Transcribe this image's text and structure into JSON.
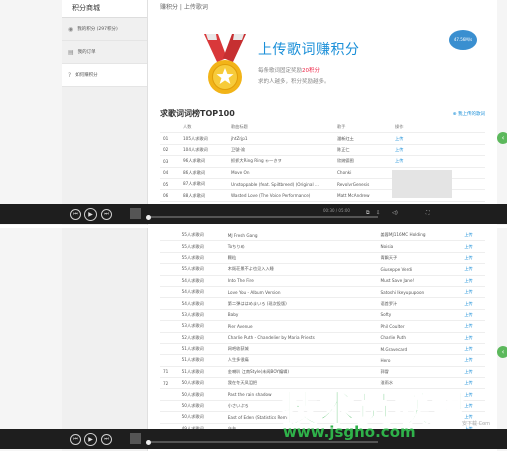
{
  "top": {
    "sidebar": {
      "header": "积分商城",
      "items": [
        {
          "label": "我的积分 (297积分)",
          "icon": "coin-icon"
        },
        {
          "label": "我的订单",
          "icon": "list-icon"
        },
        {
          "label": "如何赚积分",
          "icon": "question-icon"
        }
      ]
    },
    "breadcrumb": "赚积分  |  上传歌词",
    "hero": {
      "title": "上传歌词赚积分",
      "line1_pre": "每条歌词固定奖励",
      "line1_hl": "20积分",
      "line2": "求的人越多，积分奖励越多。"
    },
    "section": {
      "title": "求歌词词榜TOP100",
      "link": "我上传的歌词"
    },
    "table": {
      "headers": [
        "",
        "人数",
        "歌曲标题",
        "歌手",
        "操作"
      ],
      "rows": [
        [
          "01",
          "105人求歌词",
          "jhtZrjp1",
          "潘新红土",
          "上传"
        ],
        [
          "02",
          "104人求歌词",
          "卫號-渝",
          "陈正仁",
          "上传"
        ],
        [
          "03",
          "96人求歌词",
          "抓抓大Ring Ring ゃ一きヲ",
          "欣婉德图",
          "上传"
        ],
        [
          "04",
          "86人求歌词",
          "Move On",
          "Chonki",
          "上传"
        ],
        [
          "05",
          "87人求歌词",
          "Unstoppable (feat. Spiltbreed) (Original ...",
          "RevolvrGenesis",
          "上传"
        ],
        [
          "06",
          "88人求歌词",
          "Wasted Love (The Voice Performance)",
          "Matt McAndrew",
          "上传"
        ]
      ]
    },
    "player": {
      "time": "00:30 / 05:00"
    },
    "badge": "47.56M/s"
  },
  "bottom": {
    "table": {
      "rows": [
        [
          "",
          "55人求歌词",
          "MJ Fresh Gang",
          "姜蓉MJ116MC Holding",
          "上传"
        ],
        [
          "",
          "55人求歌词",
          "Toちりめ",
          "Noisia",
          "上传"
        ],
        [
          "",
          "55人求歌词",
          "颗粒",
          "青飘天子",
          "上传"
        ],
        [
          "",
          "55人求歌词",
          "木既荘景不よ也见入入睡",
          "Giuseppe Verdi",
          "上传"
        ],
        [
          "",
          "54人求歌词",
          "Into The Fire",
          "Must Save Jane!",
          "上传"
        ],
        [
          "",
          "54人求歌词",
          "Love You - Album Version",
          "Satoshi Ikeyupupoon",
          "上传"
        ],
        [
          "",
          "54人求歌词",
          "第二弹ははめまいろ (现次投版)",
          "语首罗汁",
          "上传"
        ],
        [
          "",
          "53人求歌词",
          "Baby",
          "Softy",
          "上传"
        ],
        [
          "",
          "53人求歌词",
          "Pier Avenue",
          "Phil Coulter",
          "上传"
        ],
        [
          "",
          "52人求歌词",
          "Charlie Puth - Chandelier by Maria Priests",
          "Charlie Puth",
          "上传"
        ],
        [
          "",
          "51人求歌词",
          "网吧收获城",
          "M.Gravecard",
          "上传"
        ],
        [
          "",
          "51人求歌词",
          "人生多很痛",
          "Hero",
          "上传"
        ],
        [
          "71",
          "51人求歌词",
          "金喇叭 江南Style(未闻BOY编辑)",
          "郭冒",
          "上传"
        ],
        [
          "72",
          "50人求歌词",
          "我在冬天凤泪把",
          "淮雨水",
          "上传"
        ],
        [
          "",
          "50人求歌词",
          "Past the rain shadow",
          "",
          "上传"
        ],
        [
          "",
          "50人求歌词",
          "小さいぷろ",
          "",
          "上传"
        ],
        [
          "",
          "50人求歌词",
          "East of Eden (Statistics Remix)",
          "",
          "上传"
        ],
        [
          "",
          "49人求歌词",
          "乌台",
          "",
          "上传"
        ]
      ]
    }
  },
  "watermark": {
    "text": "技术员联盟",
    "url": "www.jsgho.com",
    "corner": "安下载 Com"
  }
}
